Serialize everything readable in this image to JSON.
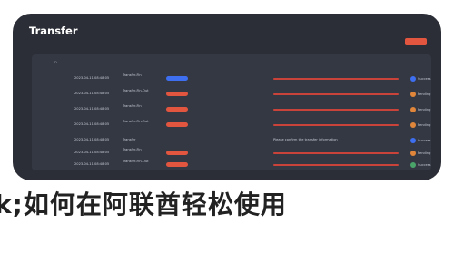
{
  "window": {
    "title": "Transfer"
  },
  "table": {
    "headers": [
      "ID",
      "",
      "",
      "",
      "",
      "",
      ""
    ],
    "rows": [
      {
        "id": "",
        "time": "2023-04-11 08:48:05",
        "name": "Transfer-Fin",
        "type": "",
        "mid": "",
        "desc": "",
        "status": "Success"
      },
      {
        "id": "",
        "time": "2023-04-11 08:48:05",
        "name": "Transfer-Fin-Out",
        "type": "",
        "mid": "",
        "desc": "",
        "status": "Pending"
      },
      {
        "id": "",
        "time": "2023-04-11 08:48:05",
        "name": "Transfer-Fin",
        "type": "",
        "mid": "",
        "desc": "",
        "status": "Pending"
      },
      {
        "id": "",
        "time": "2023-04-11 08:48:05",
        "name": "Transfer-Fin-Out",
        "type": "",
        "mid": "",
        "desc": "",
        "status": "Pending"
      },
      {
        "id": "",
        "time": "2023-04-11 08:48:05",
        "name": "Transfer",
        "type": "",
        "mid": "",
        "desc": "Please confirm the transfer information",
        "status": "Success"
      },
      {
        "id": "",
        "time": "2023-04-11 08:48:05",
        "name": "Transfer-Fin",
        "type": "",
        "mid": "",
        "desc": "",
        "status": "Pending"
      },
      {
        "id": "",
        "time": "2023-04-11 08:48:05",
        "name": "Transfer-Fin-Out",
        "type": "",
        "mid": "",
        "desc": "",
        "status": "Success"
      }
    ]
  },
  "colors": {
    "window_bg": "#2b2e36",
    "panel_bg": "#343843",
    "accent_red": "#e2553f",
    "accent_blue": "#3e6ff0",
    "success_green": "#4aa56a",
    "warning_orange": "#e0863a"
  },
  "banner": {
    "text": "k;如何在阿联酋轻松使用"
  }
}
